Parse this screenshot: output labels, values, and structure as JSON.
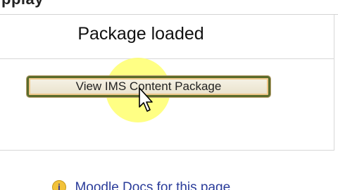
{
  "header": {
    "partial_text": "pplay"
  },
  "main": {
    "title": "Package loaded",
    "view_button_label": "View IMS Content Package"
  },
  "footer": {
    "help_icon_glyph": "i",
    "docs_link_label": "Moodle Docs for this page"
  },
  "colors": {
    "highlight": "#ffff6e",
    "button_border": "#5a6b2a",
    "link": "#2a3c9a"
  },
  "icons": {
    "cursor": "mouse-pointer-icon",
    "help": "info-icon"
  }
}
